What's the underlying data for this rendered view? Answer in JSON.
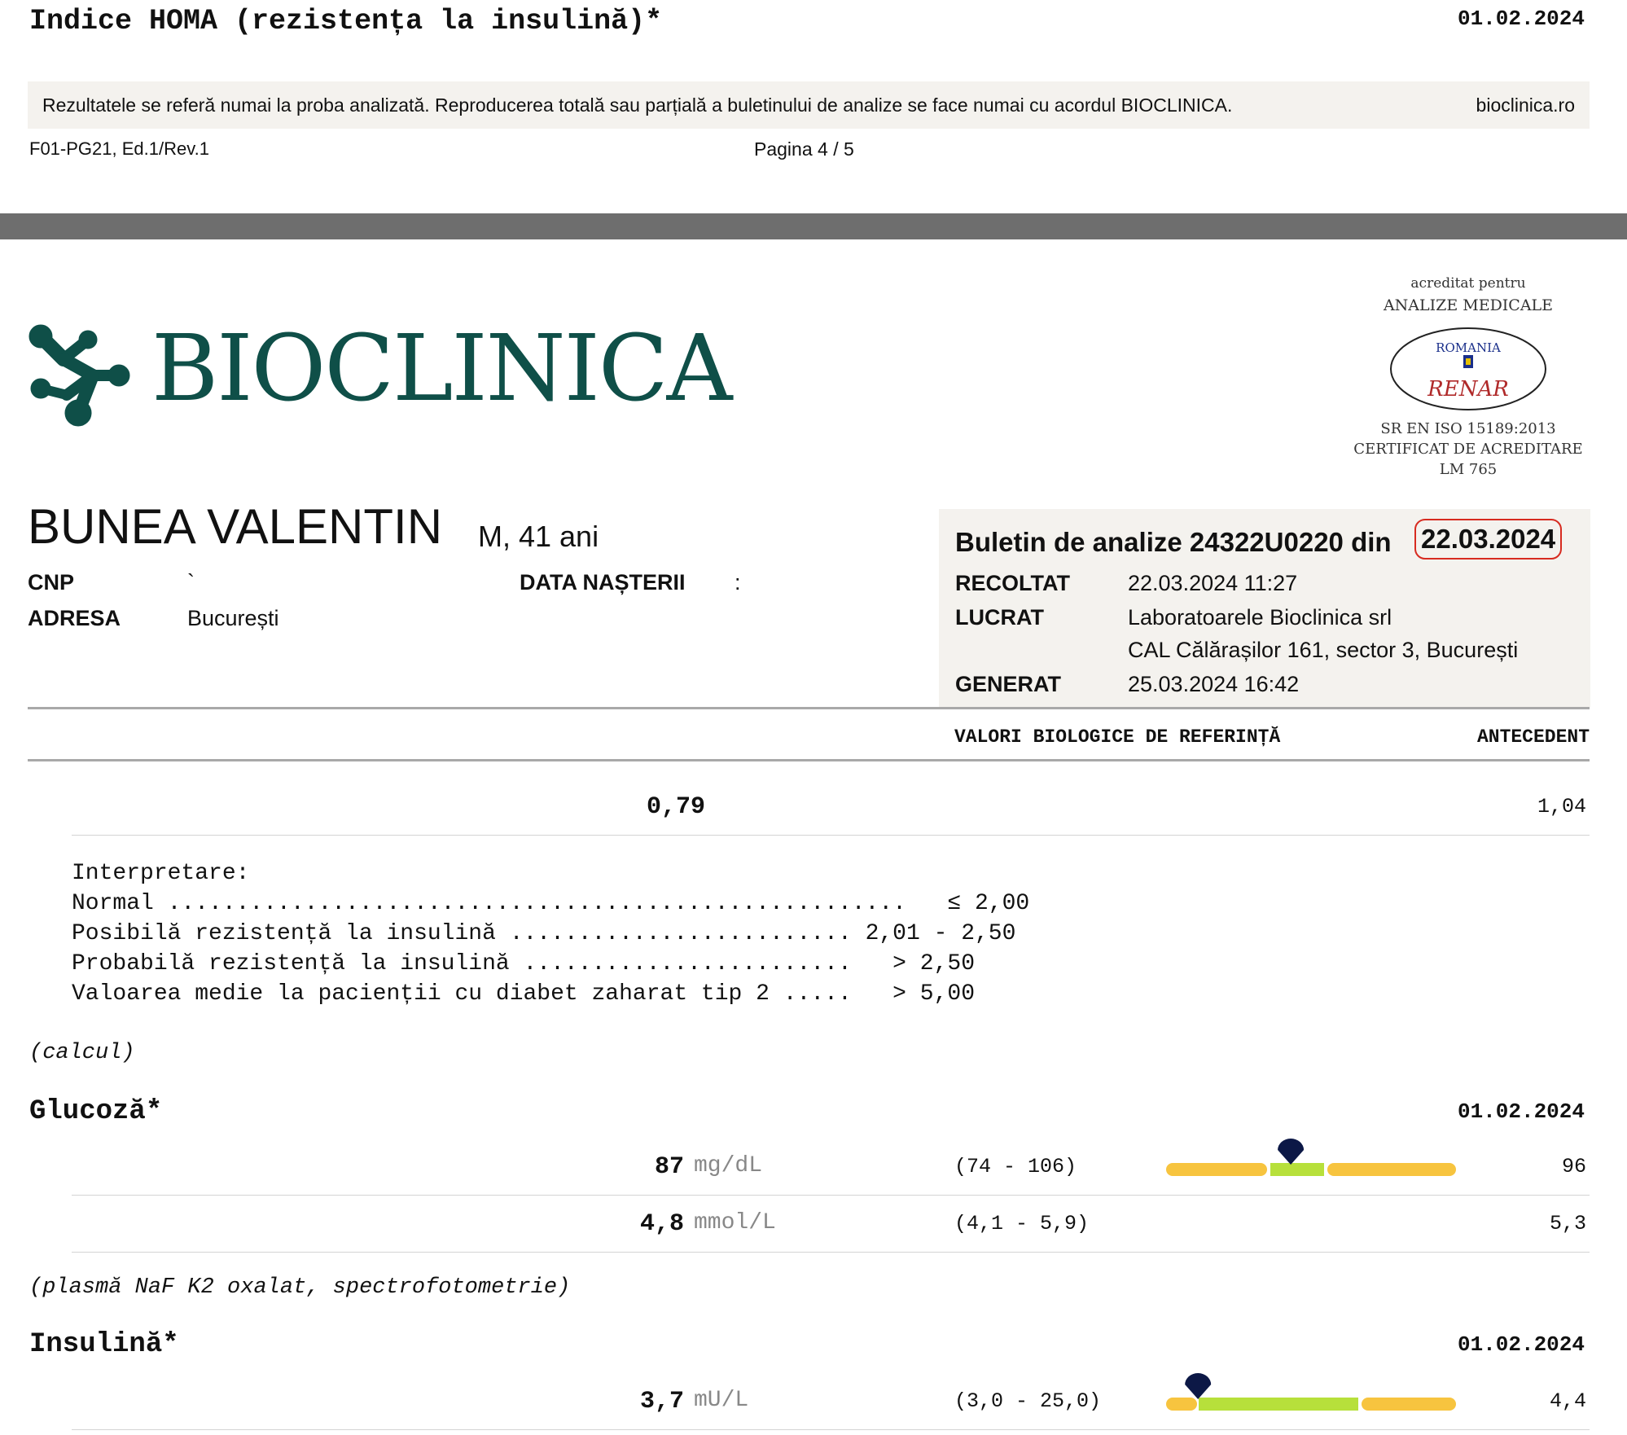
{
  "prev_page": {
    "section_title": "Indice HOMA (rezistența la insulină)*",
    "section_date": "01.02.2024",
    "disclaimer": "Rezultatele se referă numai la proba analizată. Reproducerea totală sau parțială a buletinului de analize se face numai cu acordul BIOCLINICA.",
    "website": "bioclinica.ro",
    "form_code": "F01-PG21, Ed.1/Rev.1",
    "page_number": "Pagina 4 / 5"
  },
  "header": {
    "brand": "BIOCLINICA",
    "accreditation": {
      "line1": "acreditat pentru",
      "line2": "ANALIZE MEDICALE",
      "seal_top": "ROMANIA",
      "seal_bottom": "RENAR",
      "standard": "SR EN ISO 15189:2013",
      "certificate": "CERTIFICAT DE ACREDITARE",
      "code": "LM 765"
    }
  },
  "patient": {
    "name": "BUNEA VALENTIN",
    "sex_age": "M, 41 ani",
    "cnp_label": "CNP",
    "cnp_value": "`",
    "birth_label": "DATA NAȘTERII",
    "birth_value": ":",
    "address_label": "ADRESA",
    "address_value": "București"
  },
  "bulletin": {
    "title": "Buletin de analize 24322U0220 din",
    "date": "22.03.2024",
    "collected_label": "RECOLTAT",
    "collected_value": "22.03.2024 11:27",
    "worked_label": "LUCRAT",
    "worked_value": "Laboratoarele Bioclinica srl",
    "worked_address": "CAL Călărașilor 161, sector 3, București",
    "generated_label": "GENERAT",
    "generated_value": "25.03.2024 16:42"
  },
  "columns": {
    "reference": "VALORI BIOLOGICE DE REFERINȚĂ",
    "previous": "ANTECEDENT"
  },
  "homa": {
    "value": "0,79",
    "previous": "1,04",
    "interpretation_title": "Interpretare:",
    "interpretation": [
      {
        "label": "Normal ......................................................",
        "range": "   ≤ 2,00"
      },
      {
        "label": "Posibilă rezistență la insulină .........................",
        "range": " 2,01 - 2,50"
      },
      {
        "label": "Probabilă rezistență la insulină ........................",
        "range": "   > 2,50"
      },
      {
        "label": "Valoarea medie la pacienții cu diabet zaharat tip 2 .....",
        "range": "   > 5,00"
      }
    ],
    "method": "(calcul)"
  },
  "glucose": {
    "title": "Glucoză*",
    "date": "01.02.2024",
    "rows": [
      {
        "value": "87",
        "unit": "mg/dL",
        "range": "(74 - 106)",
        "previous": "96",
        "position_fraction": 0.43
      },
      {
        "value": "4,8",
        "unit": "mmol/L",
        "range": "(4,1 - 5,9)",
        "previous": "5,3"
      }
    ],
    "method": "(plasmă NaF K2 oxalat, spectrofotometrie)"
  },
  "insulin": {
    "title": "Insulină*",
    "date": "01.02.2024",
    "rows": [
      {
        "value": "3,7",
        "unit": "mU/L",
        "range": "(3,0 - 25,0)",
        "previous": "4,4",
        "position_fraction": 0.11
      }
    ]
  },
  "colors": {
    "brand": "#0f4f48",
    "gauge_low_high": "#f7c43f",
    "gauge_normal": "#b7e03b",
    "marker": "#0c1846",
    "highlight": "#d72b20"
  }
}
